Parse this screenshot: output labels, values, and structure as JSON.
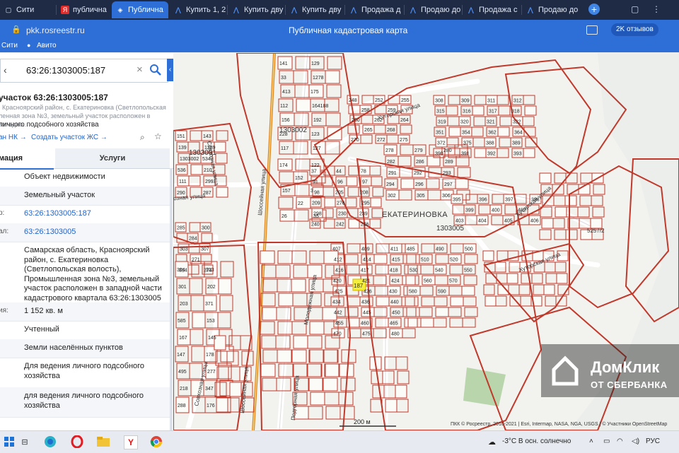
{
  "tabs": [
    {
      "label": "Сити",
      "icon": "page-icon",
      "active": false
    },
    {
      "label": "публична",
      "icon": "yandex-icon",
      "active": false
    },
    {
      "label": "Публична",
      "icon": "map-icon",
      "active": true
    },
    {
      "label": "Купить 1, 2",
      "icon": "realty-icon",
      "active": false
    },
    {
      "label": "Купить дву",
      "icon": "realty-icon",
      "active": false
    },
    {
      "label": "Купить дву",
      "icon": "realty-icon",
      "active": false
    },
    {
      "label": "Продажа д",
      "icon": "realty-icon",
      "active": false
    },
    {
      "label": "Продаю до",
      "icon": "realty-icon",
      "active": false
    },
    {
      "label": "Продажа с",
      "icon": "realty-icon",
      "active": false
    },
    {
      "label": "Продаю до",
      "icon": "realty-icon",
      "active": false
    }
  ],
  "address_bar": {
    "url": "pkk.rosreestr.ru",
    "page_title": "Публичная кадастровая карта",
    "reviews": "2K отзывов"
  },
  "bookmarks": [
    "Сити",
    "Авито"
  ],
  "search": {
    "value": "63:26:1303005:187"
  },
  "parcel": {
    "title": "участок 63:26:1303005:187",
    "address_short": ", Красноярский район, с. Екатериновка (Светлопольская ленная зона №3, земельный участок расположен в западно...",
    "purpose": "личного подсобного хозяйства",
    "link_nk": "ан НК →",
    "link_create": "Создать участок ЖС →"
  },
  "panel_tabs": {
    "info": "мация",
    "services": "Услуги"
  },
  "rows": [
    {
      "label": "",
      "value": "Объект недвижимости",
      "link": false
    },
    {
      "label": "",
      "value": "Земельный участок",
      "link": false
    },
    {
      "label": "р:",
      "value": "63:26:1303005:187",
      "link": true
    },
    {
      "label": "ал:",
      "value": "63:26:1303005",
      "link": true
    },
    {
      "label": "",
      "value": "Самарская область, Красноярский район, с. Екатериновка (Светлопольская волость), Промышленная зона №3, земельный участок расположен в западной части кадастрового квартала 63:26:1303005",
      "link": false
    },
    {
      "label": "ия:",
      "value": "1 152 кв. м",
      "link": false
    },
    {
      "label": "",
      "value": "Учтенный",
      "link": false
    },
    {
      "label": "",
      "value": "Земли населённых пунктов",
      "link": false
    },
    {
      "label": "",
      "value": "Для ведения личного подсобного хозяйства",
      "link": false
    },
    {
      "label": "",
      "value": "для ведения личного подсобного хозяйства",
      "link": false
    }
  ],
  "map": {
    "village": "ЕКАТЕРИНОВКА",
    "streets": {
      "khutor1": "Хуторская улица",
      "khutor2": "Хуторская улица",
      "khutor3": "Хуторская улица",
      "sovkhoz1": "Совхозная улица",
      "sovkhoz2": "Совхозная улица",
      "sovkhoz3": "Совхозная улица",
      "shosse1": "Шоссейная улица",
      "shosse2": "Шоссейная улица",
      "molodezh": "Молодежная улица",
      "podgorn": "Подгорная улица"
    },
    "quarters": {
      "q1": "1303002",
      "q2": "1303001",
      "q3": "1303005",
      "q4": "5257/2"
    },
    "selected": "187",
    "scale": "200 м",
    "attribution": "ПКК © Росреестр, 2010-2021 | Esri, Intermap, NASA, NGA, USGS | © Участники OpenStreetMap",
    "parcel_numbers": [
      "151",
      "143",
      "139",
      "1289",
      "1303002",
      "534",
      "536",
      "210",
      "111",
      "299",
      "290",
      "287",
      "285",
      "300",
      "284",
      "303",
      "307",
      "271",
      "314",
      "274",
      "304",
      "313",
      "301",
      "202",
      "203",
      "371",
      "585",
      "153",
      "167",
      "145",
      "147",
      "178",
      "495",
      "277",
      "218",
      "347",
      "288",
      "176",
      "141",
      "129",
      "33",
      "1278",
      "413",
      "175",
      "112",
      "164188",
      "156",
      "192",
      "228",
      "123",
      "117",
      "127",
      "174",
      "122",
      "152",
      "157",
      "3",
      "22",
      "26",
      "35",
      "37",
      "44",
      "78",
      "91",
      "96",
      "97",
      "98",
      "205",
      "208",
      "209",
      "276",
      "295",
      "298",
      "230",
      "239",
      "240",
      "242",
      "246",
      "248",
      "252",
      "255",
      "258",
      "259",
      "260",
      "262",
      "264",
      "265",
      "268",
      "270",
      "272",
      "275",
      "278",
      "279",
      "280",
      "282",
      "286",
      "289",
      "291",
      "292",
      "293",
      "294",
      "296",
      "297",
      "302",
      "305",
      "306",
      "308",
      "309",
      "311",
      "312",
      "315",
      "316",
      "317",
      "318",
      "319",
      "320",
      "321",
      "322",
      "351",
      "354",
      "362",
      "364",
      "372",
      "375",
      "388",
      "389",
      "390",
      "391",
      "392",
      "393",
      "395",
      "396",
      "397",
      "398",
      "399",
      "400",
      "402",
      "403",
      "404",
      "405",
      "406",
      "407",
      "409",
      "411",
      "412",
      "414",
      "415",
      "416",
      "417",
      "418",
      "420",
      "421",
      "424",
      "425",
      "426",
      "430",
      "434",
      "436",
      "440",
      "442",
      "445",
      "450",
      "455",
      "460",
      "465",
      "470",
      "475",
      "480",
      "485",
      "490",
      "500",
      "510",
      "520",
      "530",
      "540",
      "550",
      "560",
      "570",
      "580",
      "590"
    ]
  },
  "domklik": {
    "title": "ДомКлик",
    "subtitle": "ОТ СБЕРБАНКА"
  },
  "taskbar": {
    "weather": "-3°C  В осн. солнечно",
    "lang": "РУС"
  }
}
